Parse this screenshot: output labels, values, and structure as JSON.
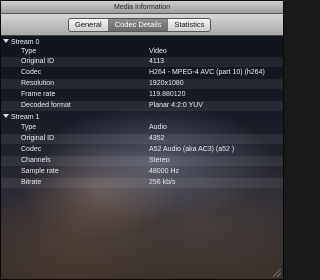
{
  "window": {
    "title": "Media Information"
  },
  "tabs": [
    {
      "label": "General",
      "active": false
    },
    {
      "label": "Codec Details",
      "active": true
    },
    {
      "label": "Statistics",
      "active": false
    }
  ],
  "streams": [
    {
      "header": "Stream 0",
      "rows": [
        {
          "key": "Type",
          "value": "Video"
        },
        {
          "key": "Original ID",
          "value": "4113"
        },
        {
          "key": "Codec",
          "value": "H264 - MPEG-4 AVC (part 10) (h264)"
        },
        {
          "key": "Resolution",
          "value": "1920x1080"
        },
        {
          "key": "Frame rate",
          "value": "119.880120"
        },
        {
          "key": "Decoded format",
          "value": "Planar 4:2:0 YUV"
        }
      ]
    },
    {
      "header": "Stream 1",
      "rows": [
        {
          "key": "Type",
          "value": "Audio"
        },
        {
          "key": "Original ID",
          "value": "4352"
        },
        {
          "key": "Codec",
          "value": "A52 Audio (aka AC3) (a52 )"
        },
        {
          "key": "Channels",
          "value": "Stereo"
        },
        {
          "key": "Sample rate",
          "value": "48000 Hz"
        },
        {
          "key": "Bitrate",
          "value": "256 kb/s"
        }
      ]
    }
  ]
}
